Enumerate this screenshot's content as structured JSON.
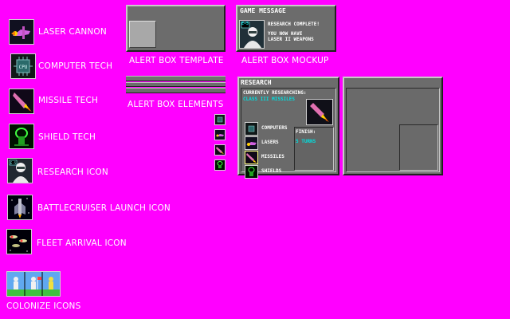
{
  "colors": {
    "background": "#ff00ff",
    "panel": "#6c6c6c",
    "text": "#ffffff",
    "accent_text": "#00e0e0"
  },
  "left_icons": [
    {
      "label": "LASER CANNON",
      "icon": "laser-cannon-icon"
    },
    {
      "label": "COMPUTER TECH",
      "icon": "cpu-chip-icon"
    },
    {
      "label": "MISSILE TECH",
      "icon": "missile-icon"
    },
    {
      "label": "SHIELD TECH",
      "icon": "shield-icon"
    },
    {
      "label": "RESEARCH ICON",
      "icon": "scientist-icon"
    },
    {
      "label": "BATTLECRUISER LAUNCH ICON",
      "icon": "battlecruiser-icon"
    },
    {
      "label": "FLEET ARRIVAL ICON",
      "icon": "fleet-icon"
    },
    {
      "label": "COLONIZE ICONS",
      "icon": "colonize-icon"
    }
  ],
  "alert_template": {
    "label": "ALERT BOX TEMPLATE"
  },
  "alert_elements": {
    "label": "ALERT BOX ELEMENTS"
  },
  "alert_mockup": {
    "label": "ALERT BOX MOCKUP",
    "title": "GAME MESSAGE",
    "badge": "E-5",
    "lines": [
      "RESEARCH COMPLETE!",
      "",
      "YOU NOW HAVE",
      "LASER II WEAPONS"
    ]
  },
  "research": {
    "title": "RESEARCH",
    "currently_label": "CURRENTLY RESEARCHING:",
    "current_item": "CLASS III MISSILES",
    "options": [
      "COMPUTERS",
      "LASERS",
      "MISSILES",
      "SHIELDS"
    ],
    "finish_label": "FINISH:",
    "finish_value": "5 TURNS"
  }
}
